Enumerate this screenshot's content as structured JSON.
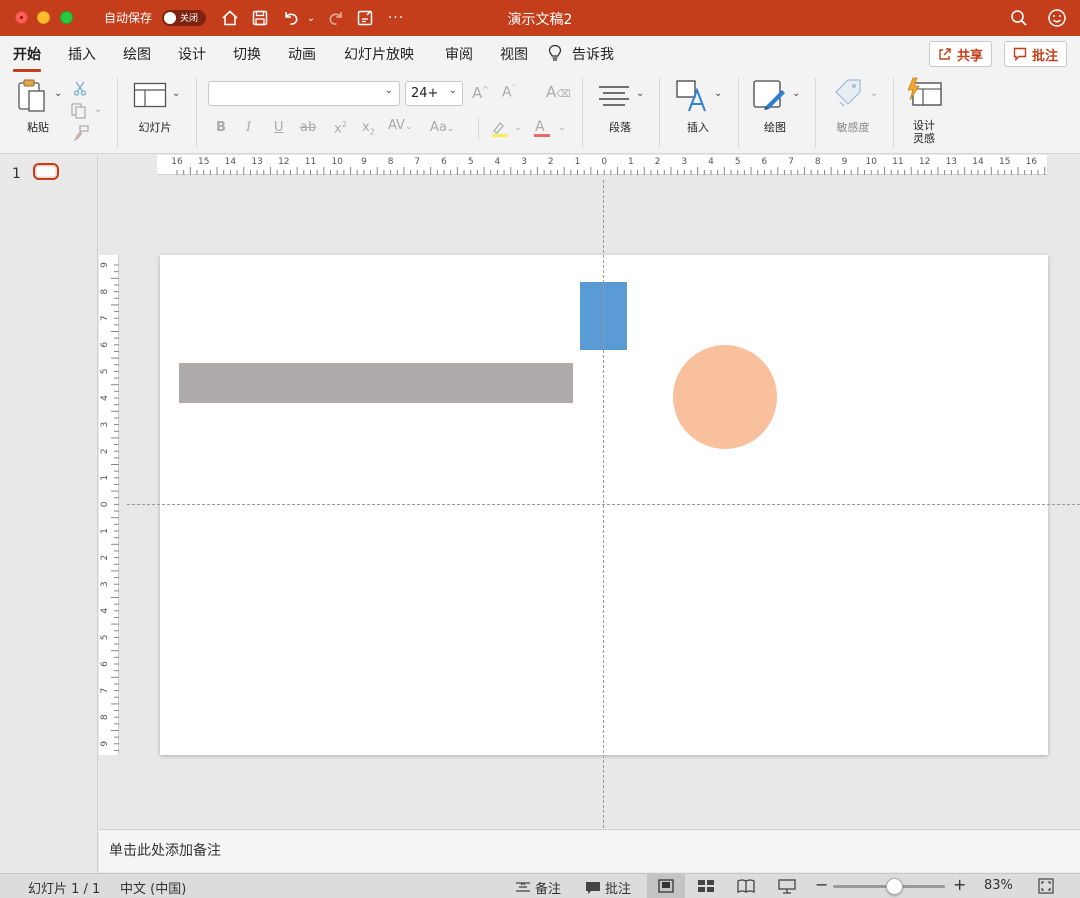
{
  "titlebar": {
    "autosave_label": "自动保存",
    "autosave_state": "关闭",
    "doc_title": "演示文稿2"
  },
  "menu": {
    "tabs": [
      "开始",
      "插入",
      "绘图",
      "设计",
      "切换",
      "动画",
      "幻灯片放映",
      "审阅",
      "视图"
    ],
    "active_tab": "开始",
    "tell_me": "告诉我",
    "share": "共享",
    "comments": "批注"
  },
  "ribbon": {
    "paste": "粘贴",
    "slide": "幻灯片",
    "font_name": "",
    "font_size": "24+",
    "paragraph": "段落",
    "insert": "插入",
    "draw": "绘图",
    "sensitivity": "敏感度",
    "designer": "设计\n灵感"
  },
  "thumbnails": {
    "slide_number": "1"
  },
  "ruler": {
    "h_labels": [
      "16",
      "15",
      "14",
      "13",
      "12",
      "11",
      "10",
      "9",
      "8",
      "7",
      "6",
      "5",
      "4",
      "3",
      "2",
      "1",
      "0",
      "1",
      "2",
      "3",
      "4",
      "5",
      "6",
      "7",
      "8",
      "9",
      "10",
      "11",
      "12",
      "13",
      "14",
      "15",
      "16"
    ],
    "v_labels": [
      "9",
      "8",
      "7",
      "6",
      "5",
      "4",
      "3",
      "2",
      "1",
      "0",
      "1",
      "2",
      "3",
      "4",
      "5",
      "6",
      "7",
      "8",
      "9"
    ]
  },
  "slide": {
    "shapes": {
      "gray_bar_color": "#aeaaaa",
      "blue_rect_color": "#5b9bd5",
      "circle_color": "#f8c09d"
    }
  },
  "notes": {
    "placeholder": "单击此处添加备注"
  },
  "status": {
    "slide_info": "幻灯片 1 / 1",
    "language": "中文 (中国)",
    "notes_btn": "备注",
    "comments_btn": "批注",
    "zoom": "83%",
    "zoom_level": 0.55
  },
  "colors": {
    "accent": "#c43e1c"
  }
}
